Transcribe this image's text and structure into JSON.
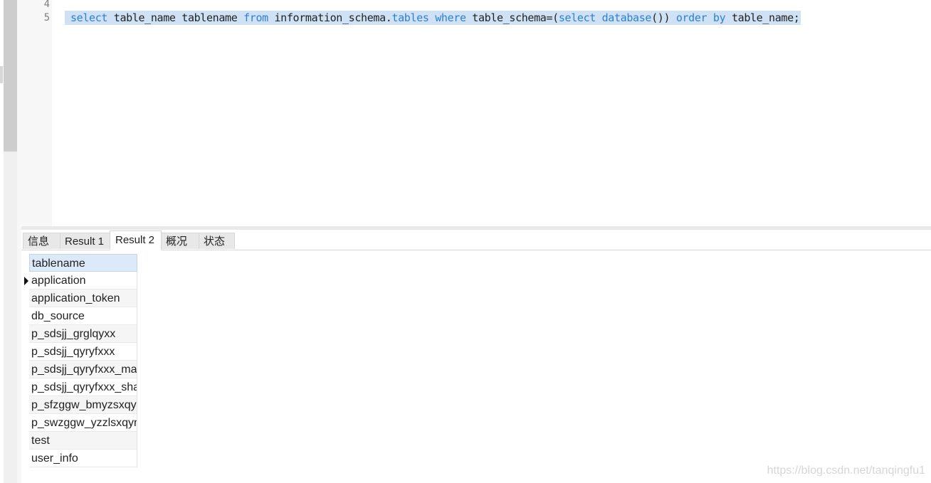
{
  "editor": {
    "line_numbers": [
      "4",
      "5"
    ],
    "tokens": [
      {
        "t": "select",
        "k": "kw"
      },
      {
        "t": " table_name tablename ",
        "k": "id"
      },
      {
        "t": "from",
        "k": "kw"
      },
      {
        "t": " information_schema.",
        "k": "id"
      },
      {
        "t": "tables",
        "k": "kw"
      },
      {
        "t": " ",
        "k": "id"
      },
      {
        "t": "where",
        "k": "kw"
      },
      {
        "t": " table_schema=(",
        "k": "id"
      },
      {
        "t": "select",
        "k": "kw"
      },
      {
        "t": " ",
        "k": "id"
      },
      {
        "t": "database",
        "k": "kw"
      },
      {
        "t": "()) ",
        "k": "id"
      },
      {
        "t": "order",
        "k": "kw"
      },
      {
        "t": " ",
        "k": "id"
      },
      {
        "t": "by",
        "k": "kw"
      },
      {
        "t": " table_name;",
        "k": "id"
      }
    ]
  },
  "tabs": [
    {
      "label": "信息",
      "active": false
    },
    {
      "label": "Result 1",
      "active": false
    },
    {
      "label": "Result 2",
      "active": true
    },
    {
      "label": "概况",
      "active": false
    },
    {
      "label": "状态",
      "active": false
    }
  ],
  "grid": {
    "column": "tablename",
    "rows": [
      "application",
      "application_token",
      "db_source",
      "p_sdsjj_grglqyxx",
      "p_sdsjj_qyryfxxx",
      "p_sdsjj_qyryfxxx_mai",
      "p_sdsjj_qyryfxxx_sha",
      "p_sfzggw_bmyzsxqy:",
      "p_swzggw_yzzlsxqyn",
      "test",
      "user_info"
    ],
    "current_row": 0
  },
  "watermark": "https://blog.csdn.net/tanqingfu1",
  "colors": {
    "keyword": "#2e7fd6",
    "selection": "#cfe2f5",
    "header": "#dbe9f8"
  }
}
